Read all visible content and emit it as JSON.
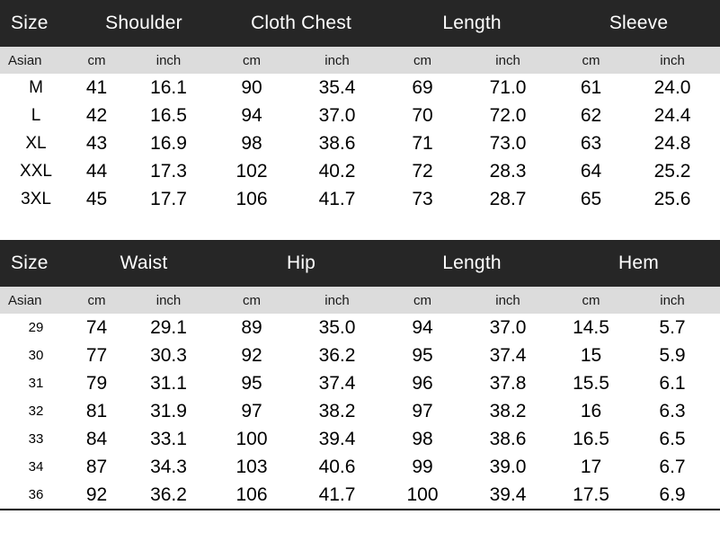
{
  "tables": [
    {
      "id": "top-size-chart",
      "groups": [
        "Size",
        "Shoulder",
        "Cloth Chest",
        "Length",
        "Sleeve"
      ],
      "units": [
        "Asian",
        "cm",
        "inch",
        "cm",
        "inch",
        "cm",
        "inch",
        "cm",
        "inch"
      ],
      "rows": [
        [
          "M",
          "41",
          "16.1",
          "90",
          "35.4",
          "69",
          "71.0",
          "61",
          "24.0"
        ],
        [
          "L",
          "42",
          "16.5",
          "94",
          "37.0",
          "70",
          "72.0",
          "62",
          "24.4"
        ],
        [
          "XL",
          "43",
          "16.9",
          "98",
          "38.6",
          "71",
          "73.0",
          "63",
          "24.8"
        ],
        [
          "XXL",
          "44",
          "17.3",
          "102",
          "40.2",
          "72",
          "28.3",
          "64",
          "25.2"
        ],
        [
          "3XL",
          "45",
          "17.7",
          "106",
          "41.7",
          "73",
          "28.7",
          "65",
          "25.6"
        ]
      ]
    },
    {
      "id": "bottom-size-chart",
      "groups": [
        "Size",
        "Waist",
        "Hip",
        "Length",
        "Hem"
      ],
      "units": [
        "Asian",
        "cm",
        "inch",
        "cm",
        "inch",
        "cm",
        "inch",
        "cm",
        "inch"
      ],
      "rows": [
        [
          "29",
          "74",
          "29.1",
          "89",
          "35.0",
          "94",
          "37.0",
          "14.5",
          "5.7"
        ],
        [
          "30",
          "77",
          "30.3",
          "92",
          "36.2",
          "95",
          "37.4",
          "15",
          "5.9"
        ],
        [
          "31",
          "79",
          "31.1",
          "95",
          "37.4",
          "96",
          "37.8",
          "15.5",
          "6.1"
        ],
        [
          "32",
          "81",
          "31.9",
          "97",
          "38.2",
          "97",
          "38.2",
          "16",
          "6.3"
        ],
        [
          "33",
          "84",
          "33.1",
          "100",
          "39.4",
          "98",
          "38.6",
          "16.5",
          "6.5"
        ],
        [
          "34",
          "87",
          "34.3",
          "103",
          "40.6",
          "99",
          "39.0",
          "17",
          "6.7"
        ],
        [
          "36",
          "92",
          "36.2",
          "106",
          "41.7",
          "100",
          "39.4",
          "17.5",
          "6.9"
        ]
      ]
    }
  ],
  "colors": {
    "header_background": "#262626",
    "header_text": "#ffffff",
    "unit_band_background": "#dcdcdc",
    "body_text": "#000000",
    "page_background": "#ffffff",
    "rule": "#000000"
  }
}
